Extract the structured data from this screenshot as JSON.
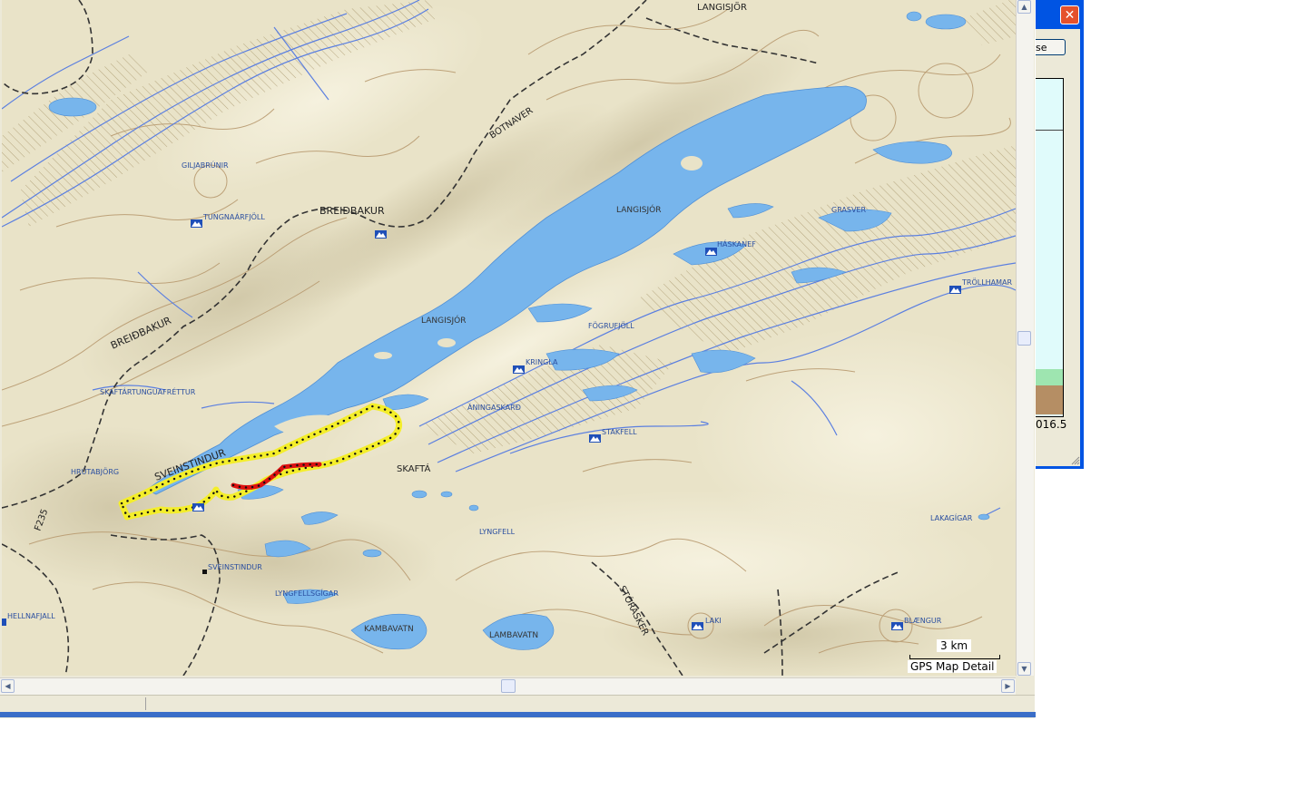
{
  "map": {
    "place_labels": {
      "langisjor_top": "LANGISJÖR",
      "botnaver": "BOTNAVER",
      "giljabrunir": "GILJABRÚNIR",
      "breidbakur_n": "BREIÐBAKUR",
      "tungnaarfjoll": "TUNGNAÁRFJÖLL",
      "langisjor_mid": "LANGISJÓR",
      "grasver": "GRASVER",
      "haskanef": "HÁSKANEF",
      "trollhamar": "TRÖLLHAMAR",
      "breidbakur_w": "BREIÐBAKUR",
      "langisjor_lake": "LANGISJÓR",
      "fogrufjoll": "FÖGRUFJÖLL",
      "kringla": "KRINGLA",
      "skaftartunguafrettur": "SKAFTÁRTUNGUAFRÉTTUR",
      "aningaskard": "ÁNINGASKARÐ",
      "stakfell": "STAKFELL",
      "sveinstindur_ridge": "SVEINSTINDUR",
      "hrutabjorg": "HRÚTABJÖRG",
      "skafta": "SKAFTÁ",
      "f235": "F235",
      "lyngfell": "LYNGFELL",
      "lakagigar": "LAKAGÍGAR",
      "sveinstindur_peak": "SVEINSTINDUR",
      "lyngfellsgigar": "LYNGFELLSGÍGAR",
      "storasker": "STÓRASKER",
      "hellnafjall": "HELLNAFJALL",
      "kambavatn": "KAMBAVATN",
      "lambavatn": "LAMBAVATN",
      "laki": "LAKI",
      "blaengur": "BLÆNGUR"
    },
    "colors": {
      "land": "#e9e3c8",
      "water": "#77b5ec",
      "river": "#5b7fe0",
      "contour": "#b89a70",
      "boundary": "#333333",
      "route_outline": "#f4ee2a",
      "route_segment": "#dd1111",
      "peak_icon": "#1f4fb8"
    }
  },
  "overlay": {
    "scale": "3 km",
    "detail": "GPS Map Detail"
  },
  "side_window": {
    "close_button": "se",
    "profile_value": "016.5"
  },
  "scrollbars": {
    "up": "▲",
    "down": "▼",
    "left": "◀",
    "right": "▶"
  }
}
